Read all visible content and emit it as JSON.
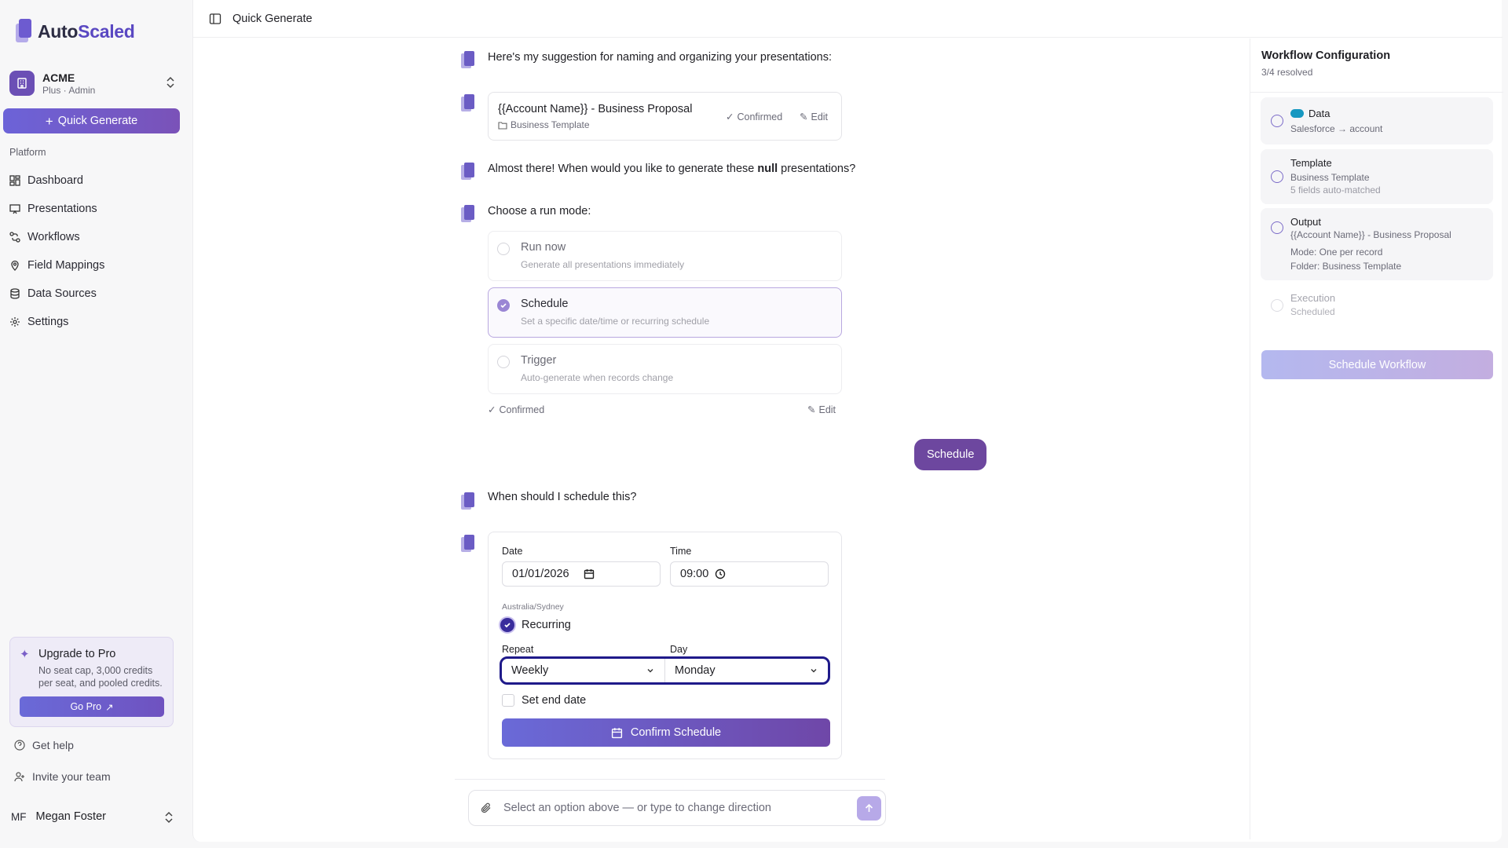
{
  "brand": {
    "name_part1": "Auto",
    "name_part2": "Scaled"
  },
  "org": {
    "name": "ACME",
    "plan": "Plus · Admin"
  },
  "sidebar": {
    "quick_generate_label": "Quick Generate",
    "section_label": "Platform",
    "items": [
      {
        "label": "Dashboard",
        "icon": "dashboard-icon"
      },
      {
        "label": "Presentations",
        "icon": "presentation-icon"
      },
      {
        "label": "Workflows",
        "icon": "workflow-icon"
      },
      {
        "label": "Field Mappings",
        "icon": "map-pin-icon"
      },
      {
        "label": "Data Sources",
        "icon": "database-icon"
      },
      {
        "label": "Settings",
        "icon": "gear-icon"
      }
    ],
    "upgrade": {
      "title": "Upgrade to Pro",
      "description": "No seat cap, 3,000 credits per seat, and pooled credits.",
      "button": "Go Pro"
    },
    "get_help": "Get help",
    "invite": "Invite your team",
    "user": {
      "initials": "MF",
      "name": "Megan Foster"
    }
  },
  "topbar": {
    "title": "Quick Generate"
  },
  "chat": {
    "msg_naming": "Here's my suggestion for naming and organizing your presentations:",
    "naming_card": {
      "title": "{{Account Name}} - Business Proposal",
      "folder": "Business Template",
      "status": "Confirmed",
      "edit": "Edit"
    },
    "msg_when_prefix": "Almost there! When would you like to generate these ",
    "msg_when_bold": "null",
    "msg_when_suffix": " presentations?",
    "msg_runmode": "Choose a run mode:",
    "modes": [
      {
        "title": "Run now",
        "desc": "Generate all presentations immediately",
        "selected": false
      },
      {
        "title": "Schedule",
        "desc": "Set a specific date/time or recurring schedule",
        "selected": true
      },
      {
        "title": "Trigger",
        "desc": "Auto-generate when records change",
        "selected": false
      }
    ],
    "mode_status": "Confirmed",
    "mode_edit": "Edit",
    "user_reply": "Schedule",
    "msg_schedule": "When should I schedule this?",
    "schedule_form": {
      "date_label": "Date",
      "date_value": "01/01/2026",
      "time_label": "Time",
      "time_value": "09:00",
      "timezone": "Australia/Sydney",
      "recurring_label": "Recurring",
      "recurring_checked": true,
      "repeat_label": "Repeat",
      "repeat_value": "Weekly",
      "day_label": "Day",
      "day_value": "Monday",
      "end_date_label": "Set end date",
      "confirm_button": "Confirm Schedule"
    },
    "composer_placeholder": "Select an option above — or type to change direction"
  },
  "workflow": {
    "title": "Workflow Configuration",
    "progress": "3/4 resolved",
    "steps": [
      {
        "title": "Data",
        "lines": [
          "Salesforce → account"
        ],
        "resolved": true,
        "icon": "salesforce-icon"
      },
      {
        "title": "Template",
        "lines": [
          "Business Template",
          "5 fields auto-matched"
        ],
        "resolved": true
      },
      {
        "title": "Output",
        "lines": [
          "{{Account Name}} - Business Proposal",
          "Mode: One per record",
          "Folder: Business Template"
        ],
        "resolved": true
      },
      {
        "title": "Execution",
        "lines": [
          "Scheduled"
        ],
        "resolved": false
      }
    ],
    "button": "Schedule Workflow"
  },
  "colors": {
    "accent": "#6d479f",
    "brand": "#5a48c2",
    "focus_ring": "#1f1a8a"
  }
}
